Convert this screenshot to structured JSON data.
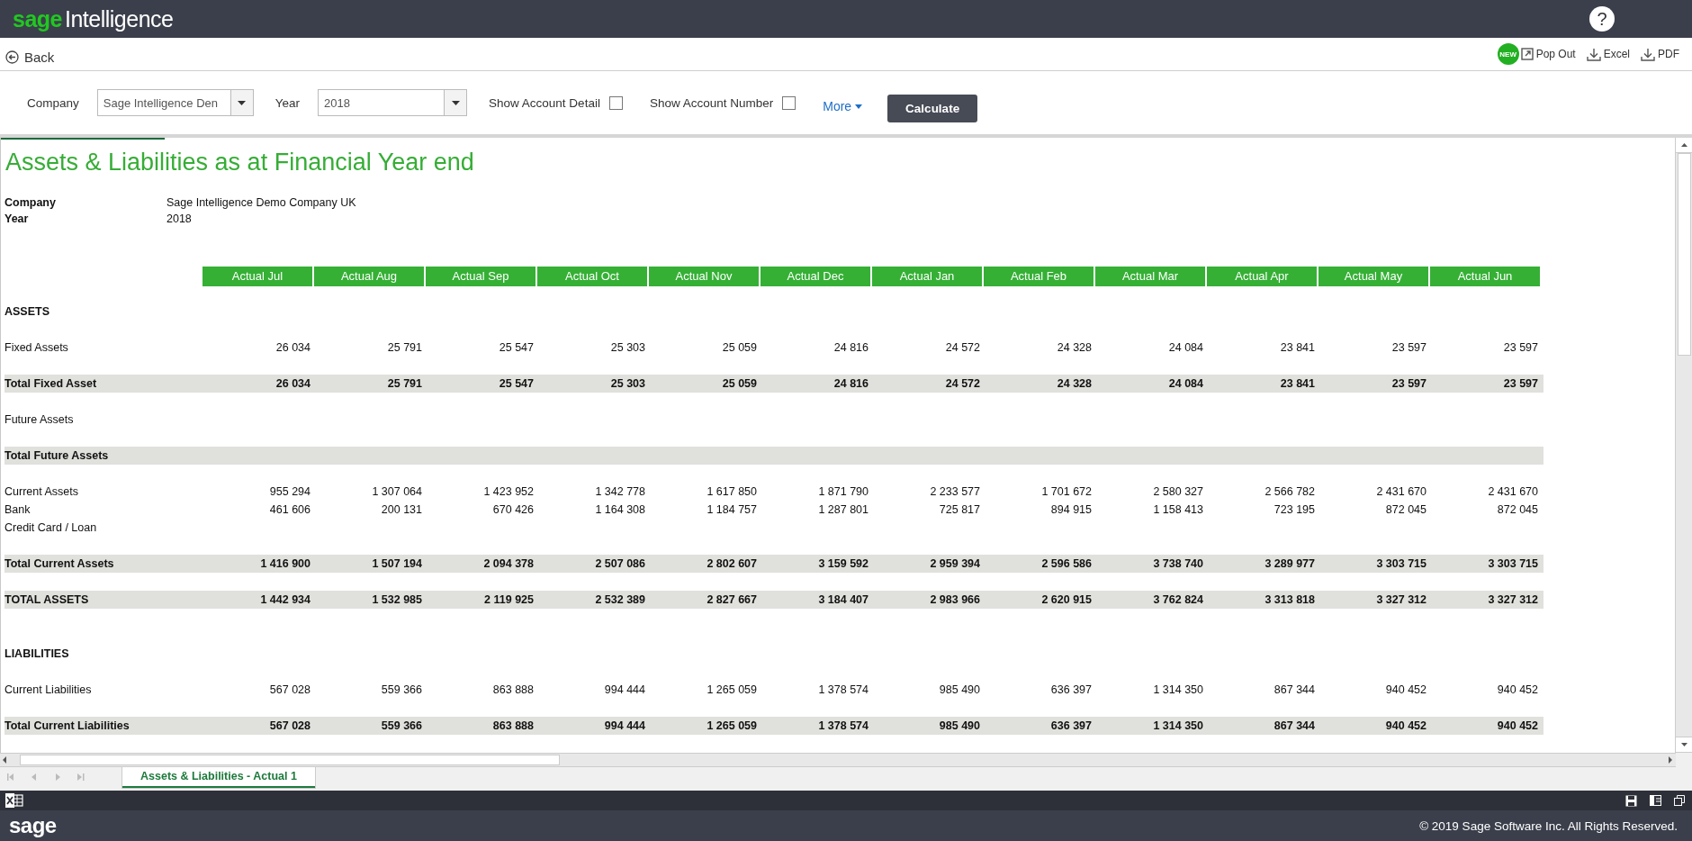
{
  "app": {
    "brand": "sage",
    "product": "Intelligence",
    "help": "?"
  },
  "nav": {
    "back": "Back",
    "new_badge": "NEW",
    "actions": [
      {
        "kind": "popout",
        "label": "Pop Out"
      },
      {
        "kind": "download",
        "label": "Excel"
      },
      {
        "kind": "download",
        "label": "PDF"
      }
    ]
  },
  "filters": {
    "company_label": "Company",
    "company_value": "Sage Intelligence Den",
    "year_label": "Year",
    "year_value": "2018",
    "options": [
      {
        "label": "Show Account Detail",
        "checked": false
      },
      {
        "label": "Show Account Number",
        "checked": false
      }
    ],
    "more": "More",
    "calculate": "Calculate"
  },
  "report": {
    "title": "Assets & Liabilities as at Financial Year end",
    "meta": [
      {
        "label": "Company",
        "value": "Sage Intelligence Demo Company UK"
      },
      {
        "label": "Year",
        "value": "2018"
      }
    ],
    "columns": [
      "Actual Jul",
      "Actual Aug",
      "Actual Sep",
      "Actual Oct",
      "Actual Nov",
      "Actual Dec",
      "Actual Jan",
      "Actual Feb",
      "Actual Mar",
      "Actual Apr",
      "Actual May",
      "Actual Jun"
    ],
    "rows": [
      {
        "kind": "spacer"
      },
      {
        "kind": "section",
        "label": "ASSETS"
      },
      {
        "kind": "spacer"
      },
      {
        "kind": "line",
        "label": "Fixed Assets",
        "values": [
          "26 034",
          "25 791",
          "25 547",
          "25 303",
          "25 059",
          "24 816",
          "24 572",
          "24 328",
          "24 084",
          "23 841",
          "23 597",
          "23 597"
        ]
      },
      {
        "kind": "spacer"
      },
      {
        "kind": "total",
        "label": "Total Fixed Asset",
        "values": [
          "26 034",
          "25 791",
          "25 547",
          "25 303",
          "25 059",
          "24 816",
          "24 572",
          "24 328",
          "24 084",
          "23 841",
          "23 597",
          "23 597"
        ]
      },
      {
        "kind": "spacer"
      },
      {
        "kind": "line",
        "label": "Future Assets"
      },
      {
        "kind": "spacer"
      },
      {
        "kind": "total",
        "label": "Total Future Assets"
      },
      {
        "kind": "spacer"
      },
      {
        "kind": "line",
        "label": "Current Assets",
        "values": [
          "955 294",
          "1 307 064",
          "1 423 952",
          "1 342 778",
          "1 617 850",
          "1 871 790",
          "2 233 577",
          "1 701 672",
          "2 580 327",
          "2 566 782",
          "2 431 670",
          "2 431 670"
        ]
      },
      {
        "kind": "line",
        "label": "Bank",
        "values": [
          "461 606",
          "200 131",
          "670 426",
          "1 164 308",
          "1 184 757",
          "1 287 801",
          "725 817",
          "894 915",
          "1 158 413",
          "723 195",
          "872 045",
          "872 045"
        ]
      },
      {
        "kind": "line",
        "label": "Credit Card / Loan"
      },
      {
        "kind": "spacer"
      },
      {
        "kind": "total",
        "label": "Total Current Assets",
        "values": [
          "1 416 900",
          "1 507 194",
          "2 094 378",
          "2 507 086",
          "2 802 607",
          "3 159 592",
          "2 959 394",
          "2 596 586",
          "3 738 740",
          "3 289 977",
          "3 303 715",
          "3 303 715"
        ]
      },
      {
        "kind": "spacer"
      },
      {
        "kind": "total",
        "label": "TOTAL ASSETS",
        "values": [
          "1 442 934",
          "1 532 985",
          "2 119 925",
          "2 532 389",
          "2 827 667",
          "3 184 407",
          "2 983 966",
          "2 620 915",
          "3 762 824",
          "3 313 818",
          "3 327 312",
          "3 327 312"
        ]
      },
      {
        "kind": "spacer"
      },
      {
        "kind": "spacer"
      },
      {
        "kind": "section",
        "label": "LIABILITIES"
      },
      {
        "kind": "spacer"
      },
      {
        "kind": "line",
        "label": "Current Liabilities",
        "values": [
          "567 028",
          "559 366",
          "863 888",
          "994 444",
          "1 265 059",
          "1 378 574",
          "985 490",
          "636 397",
          "1 314 350",
          "867 344",
          "940 452",
          "940 452"
        ]
      },
      {
        "kind": "spacer"
      },
      {
        "kind": "total",
        "label": "Total Current Liabilities",
        "values": [
          "567 028",
          "559 366",
          "863 888",
          "994 444",
          "1 265 059",
          "1 378 574",
          "985 490",
          "636 397",
          "1 314 350",
          "867 344",
          "940 452",
          "940 452"
        ]
      }
    ]
  },
  "sheet_tabs": [
    {
      "label": "Assets & Liabilities - Actual 1",
      "selected": true
    }
  ],
  "footer": {
    "brand": "sage",
    "copyright": "© 2019 Sage Software Inc. All Rights Reserved."
  }
}
